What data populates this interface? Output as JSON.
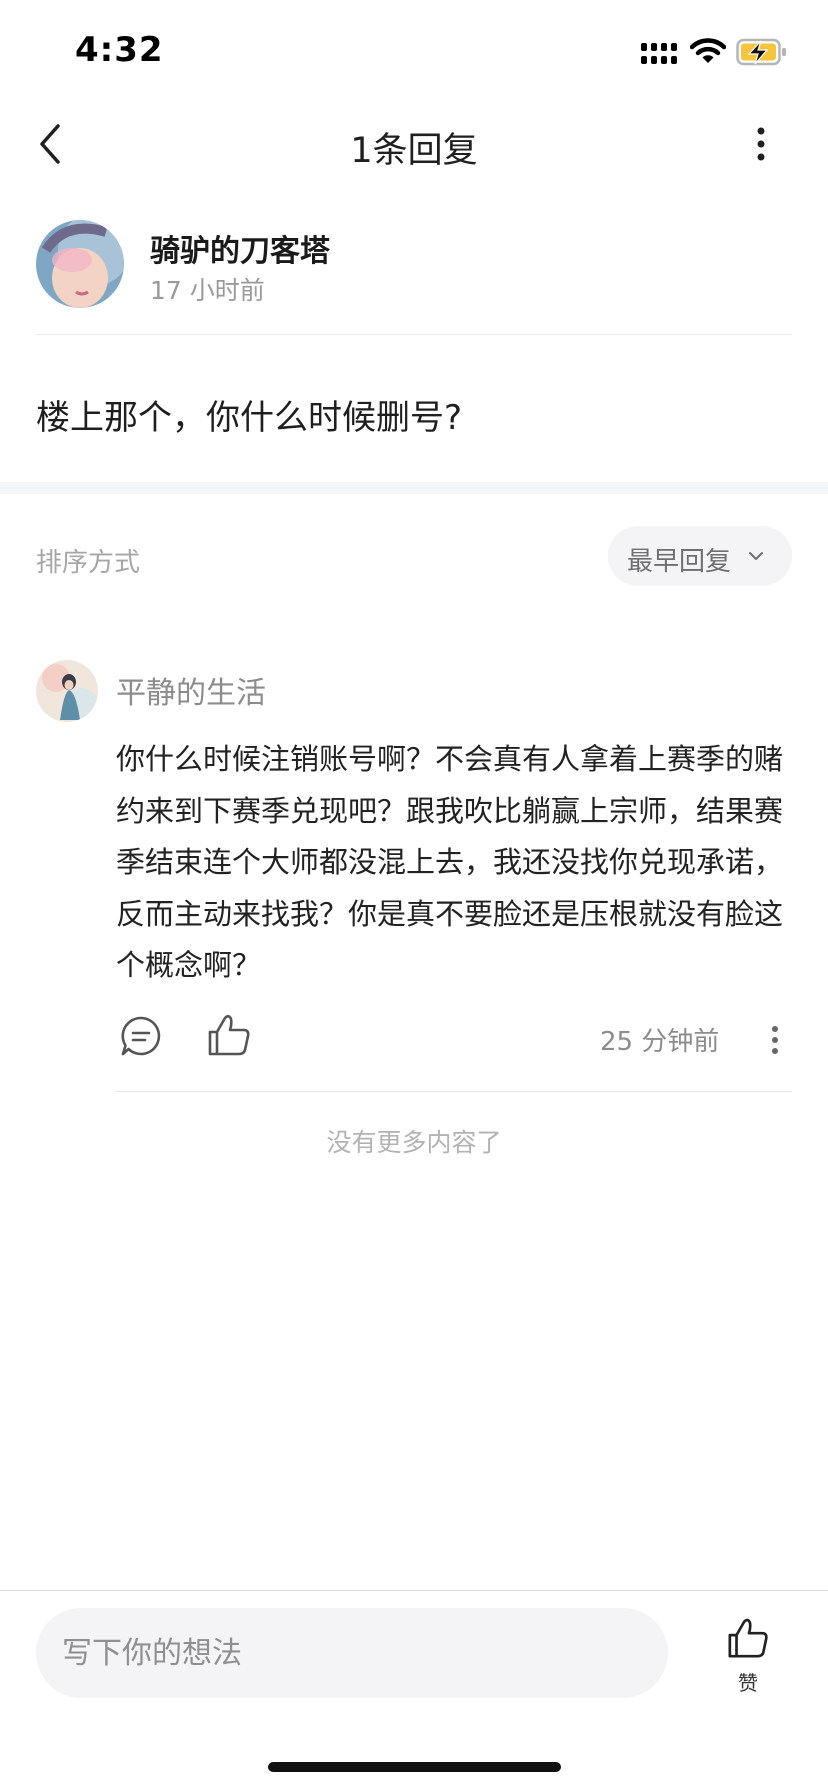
{
  "status_bar": {
    "time": "4:32"
  },
  "nav": {
    "title": "1条回复"
  },
  "post": {
    "username": "骑驴的刀客塔",
    "time": "17 小时前",
    "body": "楼上那个，你什么时候删号?"
  },
  "sort": {
    "label": "排序方式",
    "selected": "最早回复"
  },
  "reply": {
    "username": "平静的生活",
    "body": "你什么时候注销账号啊？不会真有人拿着上赛季的赌约来到下赛季兑现吧？跟我吹比躺赢上宗师，结果赛季结束连个大师都没混上去，我还没找你兑现承诺，反而主动来找我？你是真不要脸还是压根就没有脸这个概念啊？",
    "time": "25 分钟前"
  },
  "end_text": "没有更多内容了",
  "bottom_bar": {
    "input_placeholder": "写下你的想法",
    "like_label": "赞"
  },
  "colors": {
    "battery_fill": "#f7c53b",
    "muted_text": "#8c8c8c",
    "divider": "#ececec"
  },
  "icons": [
    "signal-icon",
    "wifi-icon",
    "battery-charging-icon",
    "back-icon",
    "more-vertical-icon",
    "chevron-down-icon",
    "comment-icon",
    "thumbs-up-icon"
  ]
}
